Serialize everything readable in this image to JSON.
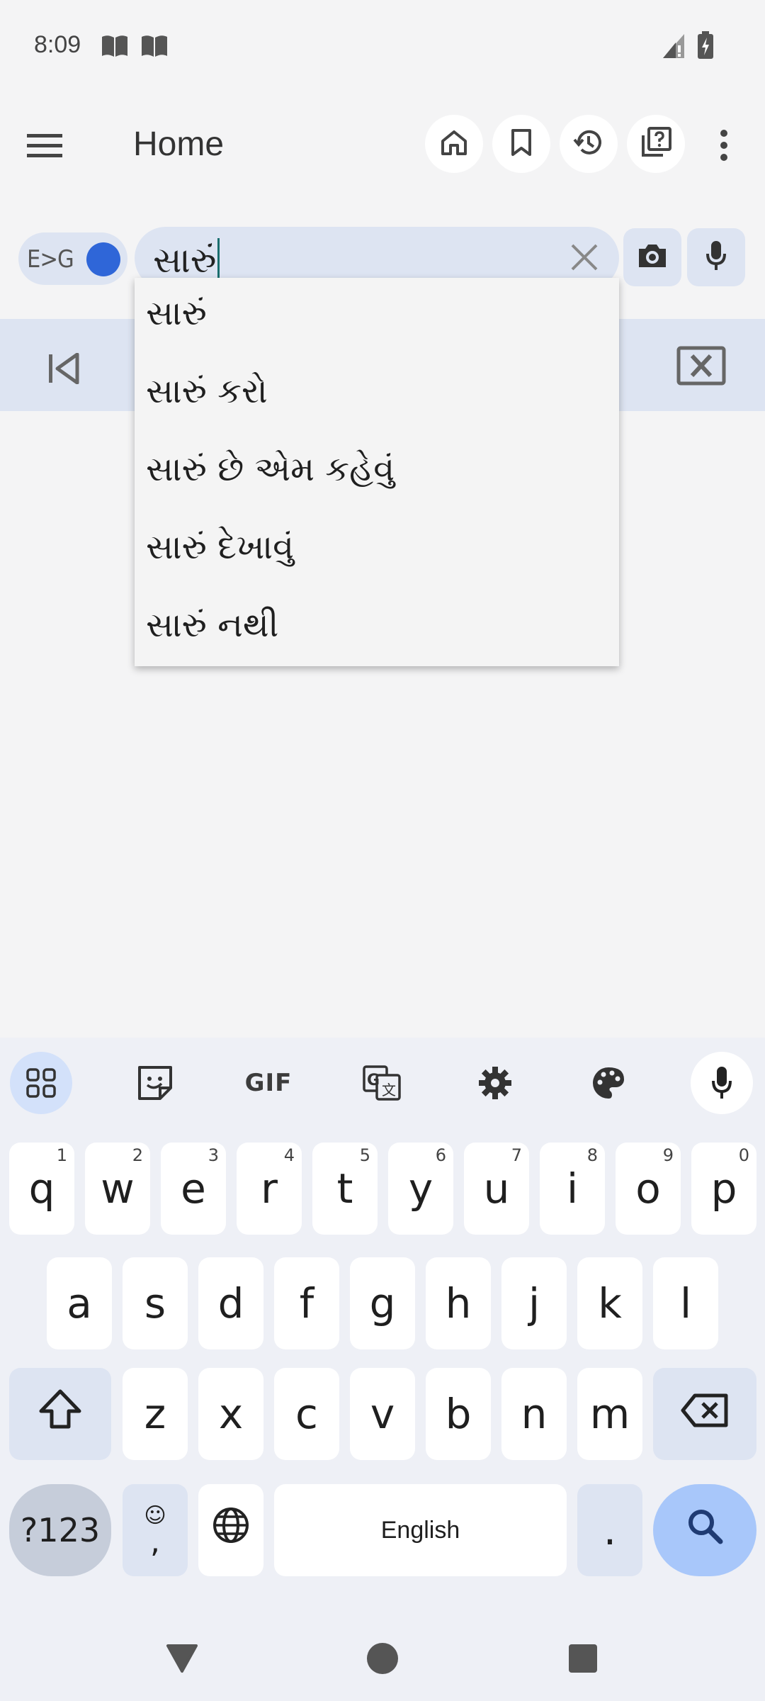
{
  "status_bar": {
    "time": "8:09",
    "notification_icons": [
      "book-icon",
      "book-icon"
    ],
    "right_icons": [
      "signal-icon",
      "battery-charging-icon"
    ]
  },
  "app_bar": {
    "title": "Home",
    "actions": [
      "home-icon",
      "bookmark-icon",
      "history-icon",
      "quiz-icon",
      "more-vert-icon"
    ]
  },
  "search": {
    "direction_label": "E>G",
    "query": "સારું",
    "actions": [
      "camera-icon",
      "mic-icon"
    ]
  },
  "suggestions": [
    "સારું",
    "સારું કરો",
    "સારું છે એમ કહેવું",
    "સારું દેખાવું",
    "સારું નથી"
  ],
  "keyboard": {
    "toolbar": [
      "apps-grid-icon",
      "sticker-icon",
      "GIF",
      "translate-icon",
      "settings-icon",
      "palette-icon",
      "mic-icon"
    ],
    "row1": [
      {
        "key": "q",
        "hint": "1"
      },
      {
        "key": "w",
        "hint": "2"
      },
      {
        "key": "e",
        "hint": "3"
      },
      {
        "key": "r",
        "hint": "4"
      },
      {
        "key": "t",
        "hint": "5"
      },
      {
        "key": "y",
        "hint": "6"
      },
      {
        "key": "u",
        "hint": "7"
      },
      {
        "key": "i",
        "hint": "8"
      },
      {
        "key": "o",
        "hint": "9"
      },
      {
        "key": "p",
        "hint": "0"
      }
    ],
    "row2": [
      "a",
      "s",
      "d",
      "f",
      "g",
      "h",
      "j",
      "k",
      "l"
    ],
    "row3": [
      "z",
      "x",
      "c",
      "v",
      "b",
      "n",
      "m"
    ],
    "symbols_label": "?123",
    "emoji_label": "☺",
    "comma_label": ",",
    "space_label": "English",
    "period_label": "."
  },
  "system_nav": [
    "back-icon",
    "home-circle-icon",
    "recents-icon"
  ],
  "colors": {
    "accent": "#2f66d8",
    "field_bg": "#dde4f2",
    "enter_key": "#a8c7fa"
  }
}
